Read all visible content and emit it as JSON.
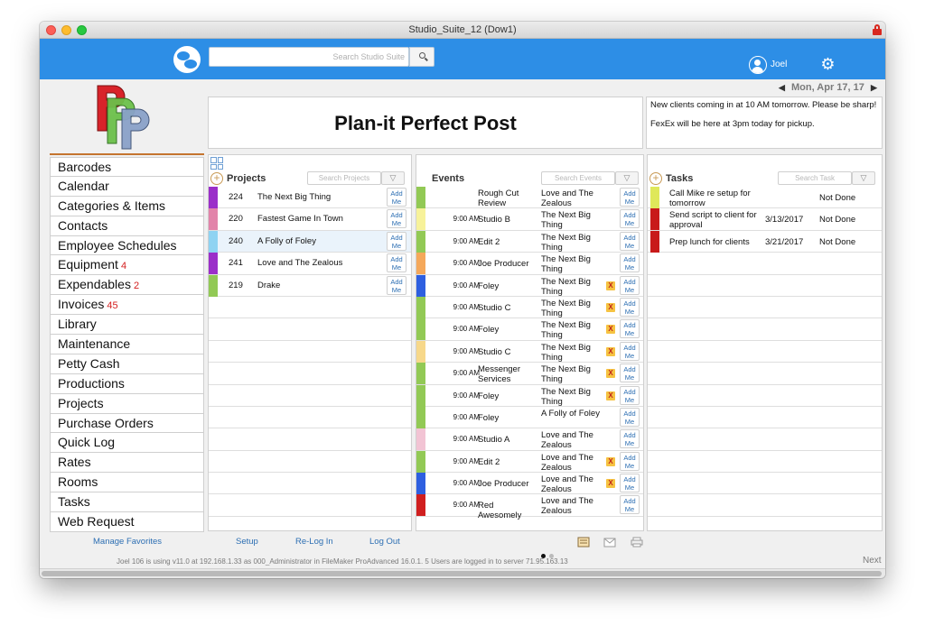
{
  "window": {
    "title": "Studio_Suite_12 (Dow1)"
  },
  "topbar": {
    "search_placeholder": "Search Studio Suite",
    "user_name": "Joel"
  },
  "date_nav": {
    "date": "Mon, Apr 17, 17",
    "prev": "◀",
    "next": "▶"
  },
  "sidebar": {
    "items": [
      {
        "label": "Barcodes",
        "badge": ""
      },
      {
        "label": "Calendar",
        "badge": ""
      },
      {
        "label": "Categories & Items",
        "badge": ""
      },
      {
        "label": "Contacts",
        "badge": ""
      },
      {
        "label": "Employee Schedules",
        "badge": ""
      },
      {
        "label": "Equipment",
        "badge": "4"
      },
      {
        "label": "Expendables",
        "badge": "2"
      },
      {
        "label": "Invoices",
        "badge": "45"
      },
      {
        "label": "Library",
        "badge": ""
      },
      {
        "label": "Maintenance",
        "badge": ""
      },
      {
        "label": "Petty Cash",
        "badge": ""
      },
      {
        "label": "Productions",
        "badge": ""
      },
      {
        "label": "Projects",
        "badge": ""
      },
      {
        "label": "Purchase Orders",
        "badge": ""
      },
      {
        "label": "Quick Log",
        "badge": ""
      },
      {
        "label": "Rates",
        "badge": ""
      },
      {
        "label": "Rooms",
        "badge": ""
      },
      {
        "label": "Tasks",
        "badge": ""
      },
      {
        "label": "Web Request",
        "badge": ""
      }
    ]
  },
  "banner": {
    "title": "Plan-it Perfect Post"
  },
  "notes": {
    "line1": "New clients coming in at 10 AM tomorrow. Please be sharp!",
    "line2": "FexEx will be here at 3pm today for pickup."
  },
  "projects": {
    "title": "Projects",
    "search_placeholder": "Search Projects",
    "add_label": "Add Me",
    "rows": [
      {
        "num": "224",
        "name": "The Next Big Thing",
        "color": "#9b2fc9"
      },
      {
        "num": "220",
        "name": "Fastest Game In Town",
        "color": "#e284aa"
      },
      {
        "num": "240",
        "name": "A Folly of Foley",
        "color": "#8fd3f2"
      },
      {
        "num": "241",
        "name": "Love and The Zealous",
        "color": "#9b2fc9"
      },
      {
        "num": "219",
        "name": "Drake",
        "color": "#92c955"
      }
    ]
  },
  "events": {
    "title": "Events",
    "search_placeholder": "Search Events",
    "add_label": "Add Me",
    "x_label": "X",
    "rows": [
      {
        "time": "",
        "room": "Rough Cut Review",
        "project": "Love and The Zealous",
        "color": "#92c955",
        "x": false
      },
      {
        "time": "9:00 AM",
        "room": "Studio B",
        "project": "The Next Big Thing",
        "color": "#f7f29a",
        "x": false
      },
      {
        "time": "9:00 AM",
        "room": "Edit 2",
        "project": "The Next Big Thing",
        "color": "#92c955",
        "x": false
      },
      {
        "time": "9:00 AM",
        "room": "Joe Producer",
        "project": "The Next Big Thing",
        "color": "#f5a85a",
        "x": false
      },
      {
        "time": "9:00 AM",
        "room": "Foley",
        "project": "The Next Big Thing",
        "color": "#2e5fe0",
        "x": true
      },
      {
        "time": "9:00 AM",
        "room": "Studio C",
        "project": "The Next Big Thing",
        "color": "#92c955",
        "x": true
      },
      {
        "time": "9:00 AM",
        "room": "Foley",
        "project": "The Next Big Thing",
        "color": "#92c955",
        "x": true
      },
      {
        "time": "9:00 AM",
        "room": "Studio C",
        "project": "The Next Big Thing",
        "color": "#f7d88a",
        "x": true
      },
      {
        "time": "9:00 AM",
        "room": "Messenger Services",
        "project": "The Next Big Thing",
        "color": "#92c955",
        "x": true
      },
      {
        "time": "9:00 AM",
        "room": "Foley",
        "project": "The Next Big Thing",
        "color": "#92c955",
        "x": true
      },
      {
        "time": "9:00 AM",
        "room": "Foley",
        "project": "A Folly of Foley",
        "color": "#92c955",
        "x": false
      },
      {
        "time": "9:00 AM",
        "room": "Studio A",
        "project": "Love and The Zealous",
        "color": "#f2c4d4",
        "x": false
      },
      {
        "time": "9:00 AM",
        "room": "Edit 2",
        "project": "Love and The Zealous",
        "color": "#92c955",
        "x": true
      },
      {
        "time": "9:00 AM",
        "room": "Joe Producer",
        "project": "Love and The Zealous",
        "color": "#2e5fe0",
        "x": true
      },
      {
        "time": "9:00 AM",
        "room": "Red Awesomely",
        "project": "Love and The Zealous",
        "color": "#d01f1f",
        "x": false
      }
    ]
  },
  "tasks": {
    "title": "Tasks",
    "search_placeholder": "Search Task",
    "rows": [
      {
        "text": "Call Mike re setup for tomorrow",
        "date": "",
        "status": "Not Done",
        "color": "#dfe85a"
      },
      {
        "text": "Send script to client for approval",
        "date": "3/13/2017",
        "status": "Not Done",
        "color": "#c81a1a"
      },
      {
        "text": "Prep lunch for clients",
        "date": "3/21/2017",
        "status": "Not Done",
        "color": "#c81a1a"
      }
    ]
  },
  "footer": {
    "manage_favorites": "Manage Favorites",
    "setup": "Setup",
    "relogin": "Re-Log In",
    "logout": "Log Out",
    "status": "Joel 106 is using v11.0 at 192.168.1.33 as 000_Administrator in FileMaker ProAdvanced 16.0.1.  5 Users are logged in to server 71.95.163.13",
    "next": "Next"
  },
  "colors": {
    "accent_blue": "#2d8ee6",
    "link_blue": "#2d6fb3",
    "badge_red": "#d42020"
  }
}
